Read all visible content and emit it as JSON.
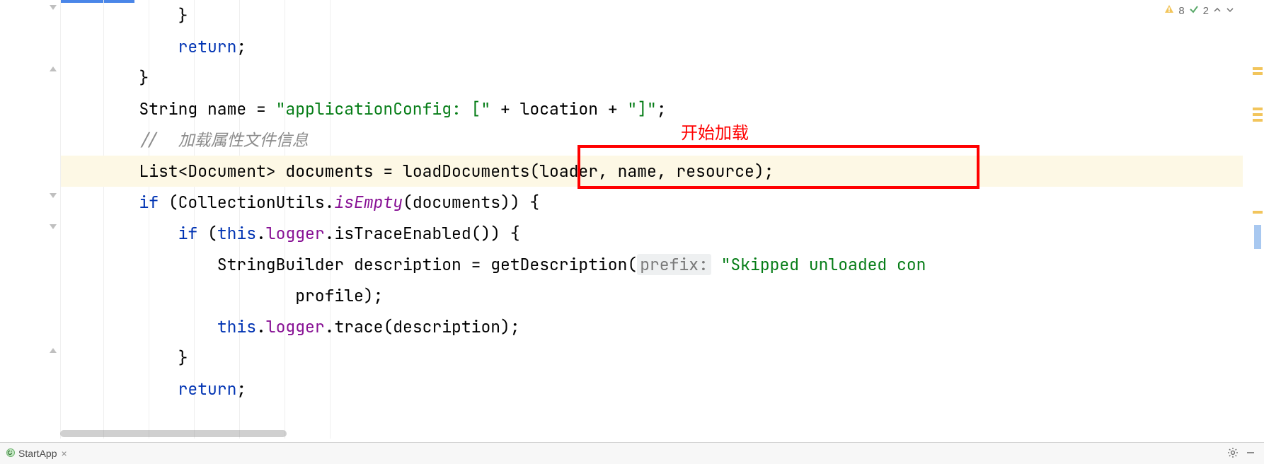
{
  "inspections": {
    "warnings": "8",
    "oks": "2"
  },
  "code": {
    "l0": "            }",
    "l1_kw": "return",
    "l1_tail": ";",
    "l2": "        }",
    "l3_a": "        String name = ",
    "l3_str1": "\"applicationConfig: [\"",
    "l3_b": " + location + ",
    "l3_str2": "\"]\"",
    "l3_c": ";",
    "l4_cmt": "//  加载属性文件信息",
    "l5_a": "        List<Document> documents = ",
    "l5_b": "loadDocuments(loader, name, resource);",
    "l6_a": "if",
    "l6_b": " (CollectionUtils.",
    "l6_it": "isEmpty",
    "l6_c": "(documents)) {",
    "l7_a": "if",
    "l7_b": " (",
    "l7_this": "this",
    "l7_dot": ".",
    "l7_log": "logger",
    "l7_c": ".isTraceEnabled()) {",
    "l8_a": "                StringBuilder description = getDescription(",
    "l8_hint": "prefix:",
    "l8_str": "\"Skipped unloaded con",
    "l9": "                        profile);",
    "l10_this": "this",
    "l10_dot": ".",
    "l10_log": "logger",
    "l10_b": ".trace(description);",
    "l11": "            }",
    "l12_kw": "return",
    "l12_tail": ";"
  },
  "annotations": {
    "label": "开始加载"
  },
  "footer": {
    "run_tab": "StartApp"
  }
}
